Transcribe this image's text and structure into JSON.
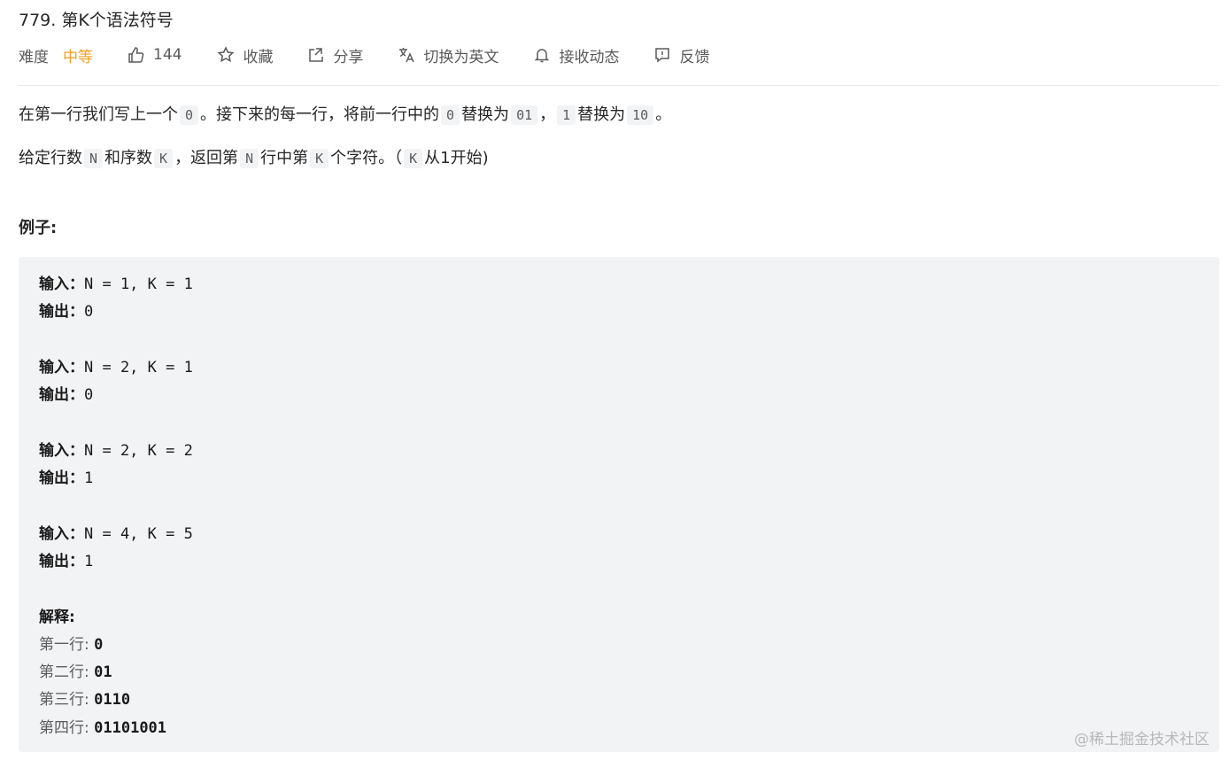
{
  "problem": {
    "title": "779. 第K个语法符号",
    "difficulty_label": "难度",
    "difficulty_value": "中等",
    "likes": "144",
    "favorite_label": "收藏",
    "share_label": "分享",
    "switch_lang_label": "切换为英文",
    "notify_label": "接收动态",
    "feedback_label": "反馈"
  },
  "colors": {
    "difficulty_medium": "#f0a020",
    "code_bg": "#f2f3f5"
  },
  "description": {
    "p1_a": "在第一行我们写上一个",
    "p1_code1": "0",
    "p1_b": "。接下来的每一行，将前一行中的",
    "p1_code2": "0",
    "p1_c": "替换为",
    "p1_code3": "01",
    "p1_d": "，",
    "p1_code4": "1",
    "p1_e": "替换为",
    "p1_code5": "10",
    "p1_f": "。",
    "p2_a": "给定行数",
    "p2_code1": "N",
    "p2_b": "和序数",
    "p2_code2": "K",
    "p2_c": "，返回第",
    "p2_code3": "N",
    "p2_d": "行中第",
    "p2_code4": "K",
    "p2_e": "个字符。（",
    "p2_code5": "K",
    "p2_f": "从1开始)"
  },
  "examples": {
    "heading": "例子:",
    "input_label": "输入：",
    "output_label": "输出：",
    "cases": [
      {
        "input": "N = 1, K = 1",
        "output": "0"
      },
      {
        "input": "N = 2, K = 1",
        "output": "0"
      },
      {
        "input": "N = 2, K = 2",
        "output": "1"
      },
      {
        "input": "N = 4, K = 5",
        "output": "1"
      }
    ],
    "explain_label": "解释:",
    "explain_rows": [
      {
        "label": "第一行: ",
        "value": "0"
      },
      {
        "label": "第二行: ",
        "value": "01"
      },
      {
        "label": "第三行: ",
        "value": "0110"
      },
      {
        "label": "第四行: ",
        "value": "01101001"
      }
    ]
  },
  "watermark": "@稀土掘金技术社区"
}
